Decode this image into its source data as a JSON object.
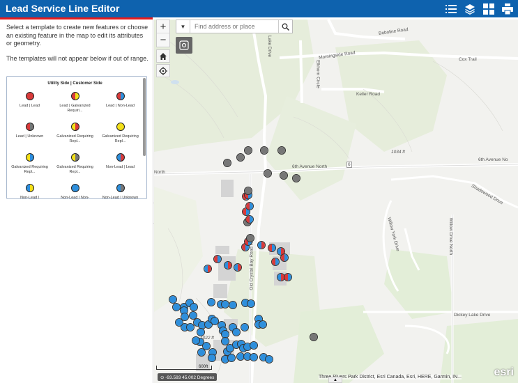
{
  "header": {
    "title": "Lead Service Line Editor",
    "icons": [
      "list-icon",
      "layers-icon",
      "basemap-gallery-icon",
      "print-icon"
    ]
  },
  "panel": {
    "instructions": "Select a template to create new features or choose an existing feature in the map to edit its attributes or geometry.",
    "range_note": "The templates will not appear below if out of range.",
    "templates_title": "Utility Side | Customer Side",
    "templates": [
      {
        "label": "Lead | Lead",
        "left": "#d93a3a",
        "right": "#d93a3a"
      },
      {
        "label": "Lead | Galvanized Requiri...",
        "left": "#d93a3a",
        "right": "#f3e01a"
      },
      {
        "label": "Lead | Non-Lead",
        "left": "#d93a3a",
        "right": "#2e8fdc"
      },
      {
        "label": "Lead | Unknown",
        "left": "#d93a3a",
        "right": "#777777"
      },
      {
        "label": "Galvanized Requiring Repl...",
        "left": "#f3e01a",
        "right": "#d93a3a"
      },
      {
        "label": "Galvanized Requiring Repl...",
        "left": "#f3e01a",
        "right": "#f3e01a"
      },
      {
        "label": "Galvanized Requiring Repl...",
        "left": "#f3e01a",
        "right": "#2e8fdc"
      },
      {
        "label": "Galvanized Requiring Repl...",
        "left": "#f3e01a",
        "right": "#777777"
      },
      {
        "label": "Non-Lead | Lead",
        "left": "#2e8fdc",
        "right": "#d93a3a"
      },
      {
        "label": "Non-Lead |",
        "left": "#2e8fdc",
        "right": "#f3e01a"
      },
      {
        "label": "Non-Lead | Non-",
        "left": "#2e8fdc",
        "right": "#2e8fdc"
      },
      {
        "label": "Non-Lead | Unknown",
        "left": "#2e8fdc",
        "right": "#777777"
      }
    ]
  },
  "map": {
    "search_placeholder": "Find address or place",
    "zoom_in": "+",
    "zoom_out": "−",
    "road_labels": [
      "Boboline Road",
      "Morningside Road",
      "Cox Trail",
      "Keller Road",
      "1034 ft",
      "6th Avenue North",
      "6th Avenue No",
      "North",
      "Shadowood Drive",
      "Willow York Drive",
      "Willow Drive North",
      "Old Crystal Bay Road North",
      "Dickey Lake Drive",
      "1022 ft",
      "Elkhorn Circle",
      "Lake Drive",
      "6"
    ],
    "scale_label": "600ft",
    "coordinates": "-93.593 45.002 Degrees",
    "attribution": "Three Rivers Park District, Esri Canada, Esri, HERE, Garmin, IN...",
    "logo": "esri"
  },
  "colors": {
    "header": "#0e62ae",
    "accent": "#e31a1c",
    "lead": "#d93a3a",
    "galvanized": "#f3e01a",
    "nonlead": "#2e8fdc",
    "unknown": "#777777"
  }
}
